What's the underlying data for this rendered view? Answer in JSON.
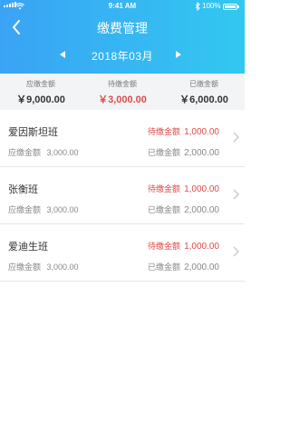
{
  "status_bar": {
    "time": "9:41 AM",
    "battery": "100%"
  },
  "header": {
    "title": "缴费管理",
    "month": "2018年03月"
  },
  "summary": [
    {
      "label": "应缴金额",
      "value": "￥9,000.00",
      "highlight": false
    },
    {
      "label": "待缴金额",
      "value": "￥3,000.00",
      "highlight": true
    },
    {
      "label": "已缴金额",
      "value": "￥6,000.00",
      "highlight": false
    }
  ],
  "classes": [
    {
      "name": "爱因斯坦班",
      "due_label": "应缴金额",
      "due": "3,000.00",
      "pending_label": "待缴金额",
      "pending": "1,000.00",
      "paid_label": "已缴金额",
      "paid": "2,000.00"
    },
    {
      "name": "张衡班",
      "due_label": "应缴金额",
      "due": "3,000.00",
      "pending_label": "待缴金额",
      "pending": "1,000.00",
      "paid_label": "已缴金额",
      "paid": "2,000.00"
    },
    {
      "name": "爱迪生班",
      "due_label": "应缴金额",
      "due": "3,000.00",
      "pending_label": "待缴金额",
      "pending": "1,000.00",
      "paid_label": "已缴金额",
      "paid": "2,000.00"
    }
  ],
  "colors": {
    "header_start": "#3aa3f5",
    "header_end": "#32c8f0",
    "pending_red": "#e04a4a"
  }
}
